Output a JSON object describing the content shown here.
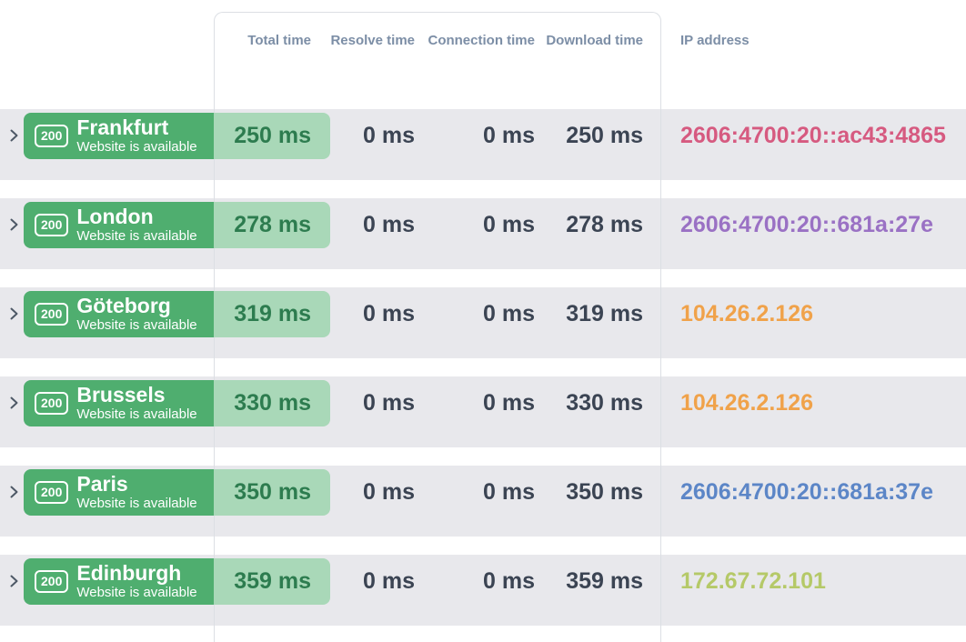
{
  "header": {
    "columns": {
      "total": "Total time",
      "resolve": "Resolve time",
      "connection": "Connection time",
      "download": "Download time",
      "ip": "IP address"
    }
  },
  "rows": [
    {
      "status_code": "200",
      "city": "Frankfurt",
      "status_text": "Website is available",
      "total": "250 ms",
      "resolve": "0 ms",
      "connection": "0 ms",
      "download": "250 ms",
      "ip": "2606:4700:20::ac43:4865",
      "ip_color": "#d65a80"
    },
    {
      "status_code": "200",
      "city": "London",
      "status_text": "Website is available",
      "total": "278 ms",
      "resolve": "0 ms",
      "connection": "0 ms",
      "download": "278 ms",
      "ip": "2606:4700:20::681a:27e",
      "ip_color": "#9a71c4"
    },
    {
      "status_code": "200",
      "city": "Göteborg",
      "status_text": "Website is available",
      "total": "319 ms",
      "resolve": "0 ms",
      "connection": "0 ms",
      "download": "319 ms",
      "ip": "104.26.2.126",
      "ip_color": "#f0a24a"
    },
    {
      "status_code": "200",
      "city": "Brussels",
      "status_text": "Website is available",
      "total": "330 ms",
      "resolve": "0 ms",
      "connection": "0 ms",
      "download": "330 ms",
      "ip": "104.26.2.126",
      "ip_color": "#f0a24a"
    },
    {
      "status_code": "200",
      "city": "Paris",
      "status_text": "Website is available",
      "total": "350 ms",
      "resolve": "0 ms",
      "connection": "0 ms",
      "download": "350 ms",
      "ip": "2606:4700:20::681a:37e",
      "ip_color": "#5c86c7"
    },
    {
      "status_code": "200",
      "city": "Edinburgh",
      "status_text": "Website is available",
      "total": "359 ms",
      "resolve": "0 ms",
      "connection": "0 ms",
      "download": "359 ms",
      "ip": "172.67.72.101",
      "ip_color": "#b5c968"
    }
  ],
  "colors": {
    "row_background": "#e8e8ec",
    "status_green": "#4fae6f",
    "status_green_light": "#a9d8b8",
    "status_green_text": "#2d7c4f",
    "value_text": "#3b4453",
    "header_text": "#7c8ea6",
    "column_border": "#dcdfe4"
  }
}
